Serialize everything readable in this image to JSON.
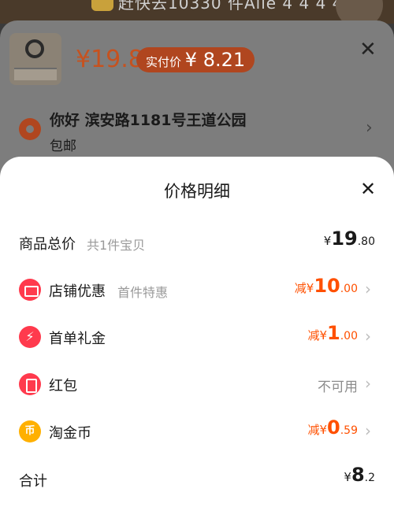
{
  "background": {
    "top_text": "赶快去10330 件Alle 4 4 4 4",
    "product_price": "¥19.8",
    "paid_label": "实付价",
    "paid_price": "¥ 8.21",
    "address": "你好 滨安路1181号王道公园",
    "shipping": "包邮"
  },
  "panel": {
    "title": "价格明细",
    "rows": {
      "total_goods": {
        "label": "商品总价",
        "sub": "共1件宝贝",
        "currency": "¥",
        "int": "19",
        "dec": ".80"
      },
      "shop_discount": {
        "label": "店铺优惠",
        "sub": "首件特惠",
        "prefix": "减",
        "currency": "¥",
        "int": "10",
        "dec": ".00"
      },
      "first_order": {
        "label": "首单礼金",
        "prefix": "减",
        "currency": "¥",
        "int": "1",
        "dec": ".00"
      },
      "red_packet": {
        "label": "红包",
        "status": "不可用"
      },
      "taobao_coin": {
        "label": "淘金币",
        "prefix": "减",
        "currency": "¥",
        "int": "0",
        "dec": ".59"
      },
      "sum": {
        "label": "合计",
        "currency": "¥",
        "int": "8",
        "dec": ".2"
      }
    }
  },
  "colors": {
    "accent": "#ff5000",
    "icon_red": "#ff3a4d",
    "coin": "#ffb000"
  },
  "icons": [
    "close-icon",
    "store-icon",
    "bolt-icon",
    "red-packet-icon",
    "coin-icon",
    "chevron-right-icon",
    "location-icon"
  ]
}
